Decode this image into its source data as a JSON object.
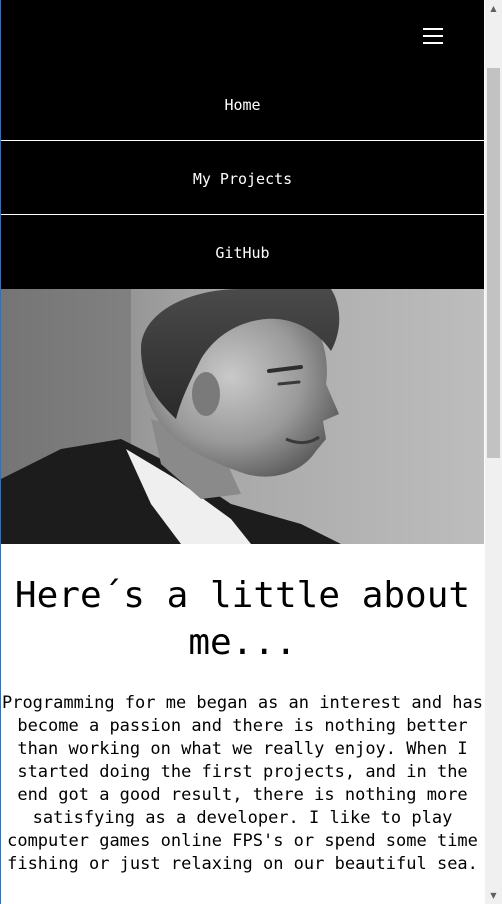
{
  "nav": {
    "menu_icon": "hamburger-menu-icon",
    "items": [
      {
        "label": "Home"
      },
      {
        "label": "My Projects"
      },
      {
        "label": "GitHub"
      }
    ]
  },
  "photo": {
    "description_icon": "profile-photo"
  },
  "about": {
    "title": "Here´s a little about me...",
    "text": "Programming for me began as an interest and has become a passion and there is nothing better than working on what we really enjoy. When I started doing the first projects, and in the end got a good result, there is nothing more satisfying as a developer. I like to play computer games online FPS's or spend some time fishing or just relaxing on our beautiful sea."
  },
  "colors": {
    "nav_background": "#000000",
    "nav_text": "#ffffff",
    "page_background": "#ffffff",
    "text": "#000000"
  },
  "scrollbar": {
    "up_icon": "scroll-up-arrow-icon",
    "down_icon": "scroll-down-arrow-icon"
  }
}
